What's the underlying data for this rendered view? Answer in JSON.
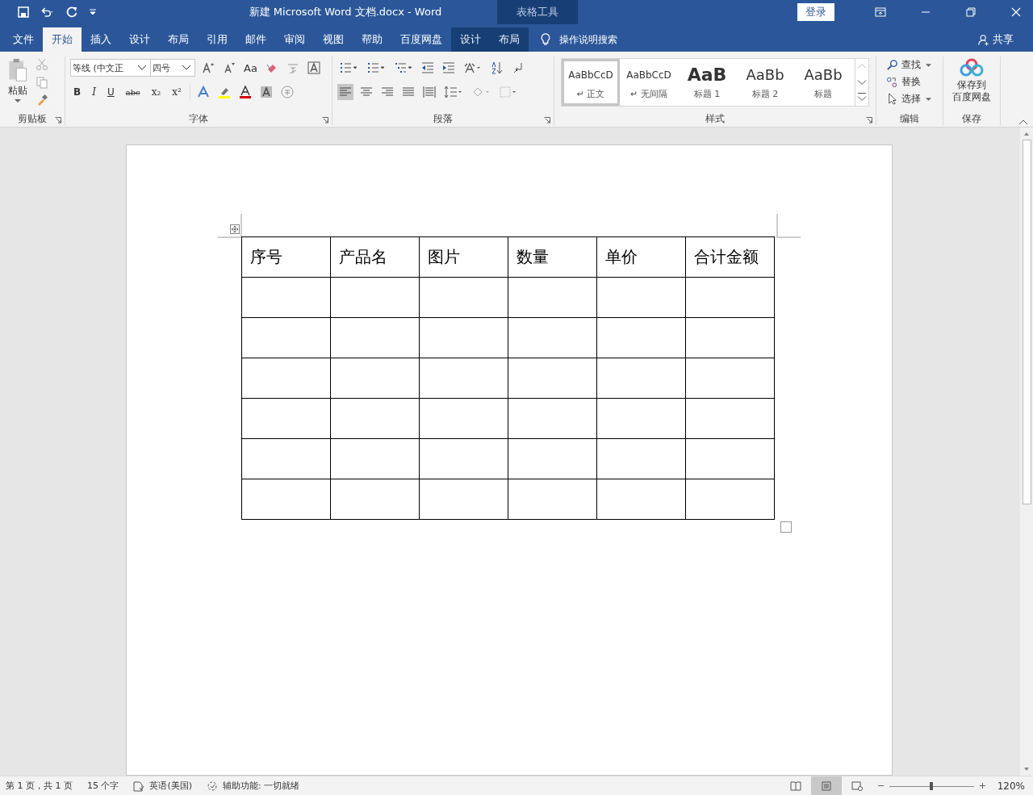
{
  "window": {
    "title": "新建 Microsoft Word 文档.docx  -  Word",
    "context_label": "表格工具",
    "sign_in": "登录"
  },
  "tabs": [
    {
      "label": "文件",
      "selected": false,
      "contextual": false
    },
    {
      "label": "开始",
      "selected": true,
      "contextual": false
    },
    {
      "label": "插入",
      "selected": false,
      "contextual": false
    },
    {
      "label": "设计",
      "selected": false,
      "contextual": false
    },
    {
      "label": "布局",
      "selected": false,
      "contextual": false
    },
    {
      "label": "引用",
      "selected": false,
      "contextual": false
    },
    {
      "label": "邮件",
      "selected": false,
      "contextual": false
    },
    {
      "label": "审阅",
      "selected": false,
      "contextual": false
    },
    {
      "label": "视图",
      "selected": false,
      "contextual": false
    },
    {
      "label": "帮助",
      "selected": false,
      "contextual": false
    },
    {
      "label": "百度网盘",
      "selected": false,
      "contextual": false
    },
    {
      "label": "设计",
      "selected": false,
      "contextual": true
    },
    {
      "label": "布局",
      "selected": false,
      "contextual": true
    }
  ],
  "tell_me": "操作说明搜索",
  "share": "共享",
  "clipboard": {
    "paste": "粘贴",
    "group": "剪贴板"
  },
  "font": {
    "name": "等线 (中文正",
    "size": "四号",
    "case": "Aa",
    "format_buttons": [
      "B",
      "I",
      "U",
      "abc",
      "x₂",
      "x²"
    ],
    "group": "字体"
  },
  "paragraph": {
    "group": "段落"
  },
  "styles": {
    "group": "样式",
    "items": [
      {
        "preview": "AaBbCcD",
        "label": "↵ 正文",
        "kind": "normal",
        "selected": true
      },
      {
        "preview": "AaBbCcD",
        "label": "↵ 无间隔",
        "kind": "normal",
        "selected": false
      },
      {
        "preview": "AaB",
        "label": "标题 1",
        "kind": "heading1",
        "selected": false
      },
      {
        "preview": "AaBb",
        "label": "标题 2",
        "kind": "heading2",
        "selected": false
      },
      {
        "preview": "AaBb",
        "label": "标题",
        "kind": "title",
        "selected": false
      }
    ]
  },
  "editing": {
    "group": "编辑",
    "find": "查找",
    "replace": "替换",
    "select": "选择"
  },
  "save": {
    "button": [
      "保存到",
      "百度网盘"
    ],
    "group": "保存"
  },
  "table": {
    "headers": [
      "序号",
      "产品名",
      "图片",
      "数量",
      "单价",
      "合计金额"
    ],
    "rows": [
      {
        "blank": true
      },
      {
        "blank": true
      },
      {
        "blank": true
      },
      {
        "blank": true
      },
      {
        "blank": true
      },
      {
        "blank": true
      }
    ]
  },
  "status_bar": {
    "items": [
      "第 1 页，共 1 页",
      "15 个字",
      "英语(美国)",
      "辅助功能: 一切就绪"
    ],
    "views": [
      {
        "kind": "read",
        "selected": false
      },
      {
        "kind": "print",
        "selected": true
      },
      {
        "kind": "web",
        "selected": false
      }
    ],
    "zoom": {
      "level": 0.5,
      "reading": "120%"
    }
  }
}
